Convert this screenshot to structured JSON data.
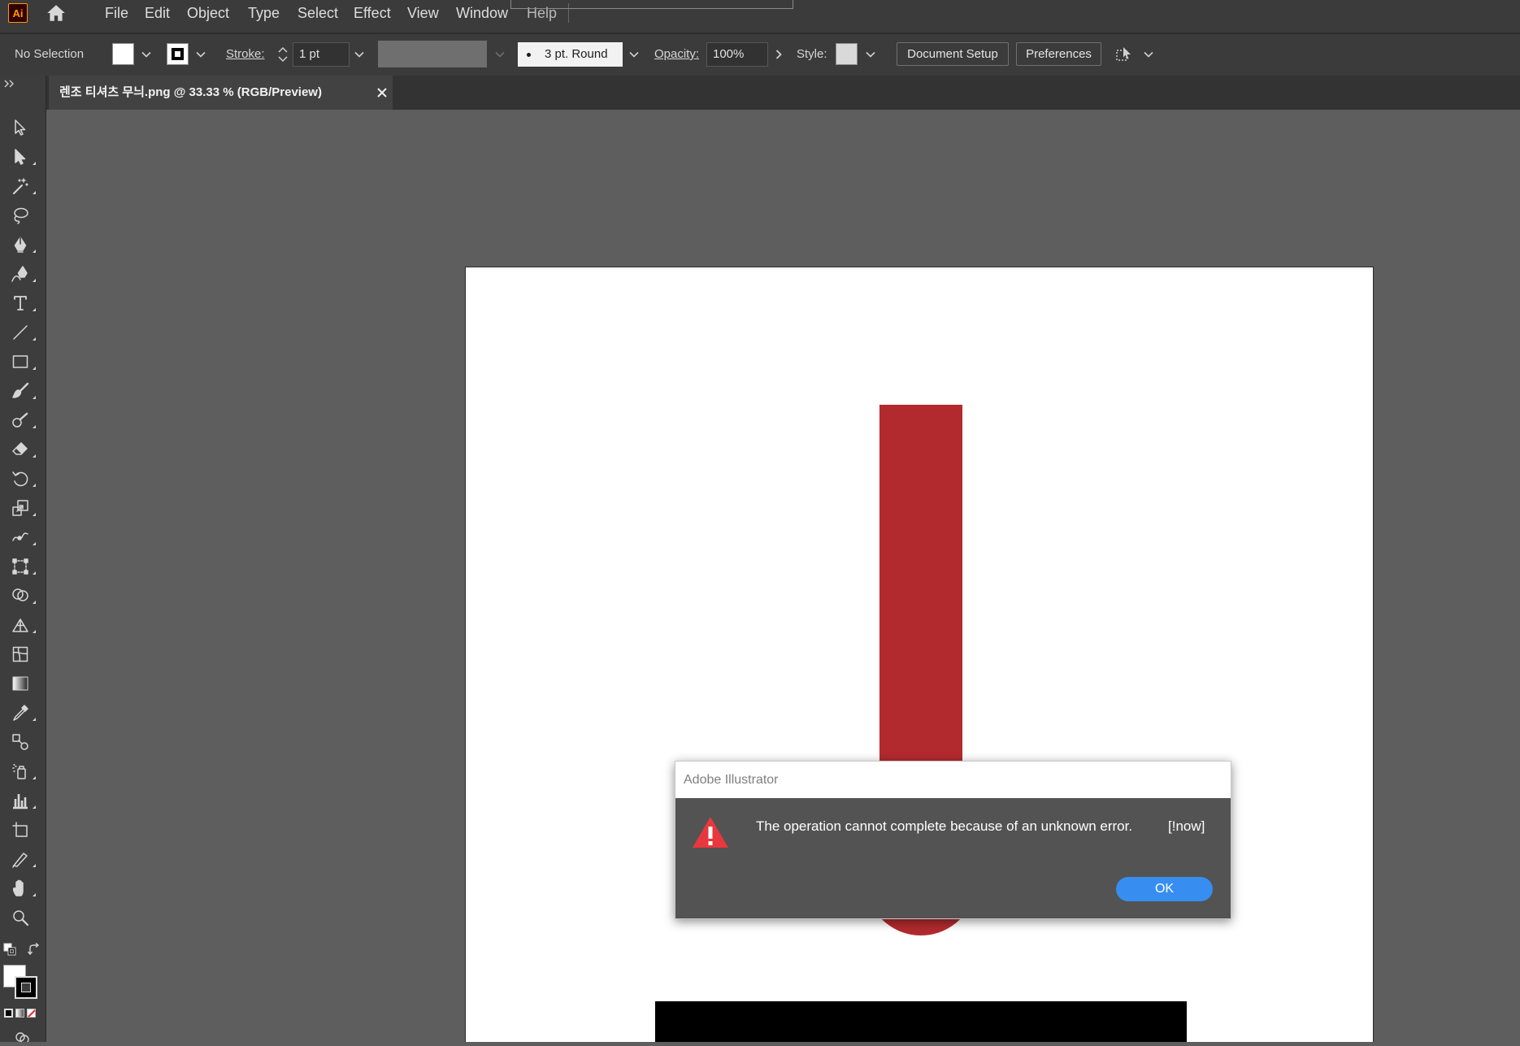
{
  "app": {
    "logo_text": "Ai"
  },
  "menu": {
    "items": [
      "File",
      "Edit",
      "Object",
      "Type",
      "Select",
      "Effect",
      "View",
      "Window",
      "Help"
    ]
  },
  "control_bar": {
    "selection_status": "No Selection",
    "stroke_label": "Stroke:",
    "stroke_weight": "1 pt",
    "brush_definition": "3 pt. Round",
    "opacity_label": "Opacity:",
    "opacity_value": "100%",
    "style_label": "Style:",
    "document_setup_button": "Document Setup",
    "preferences_button": "Preferences"
  },
  "document_tab": {
    "title": "렌조 티셔츠 무늬.png @ 33.33 % (RGB/Preview)"
  },
  "tools": [
    "selection-tool-icon",
    "direct-selection-tool-icon",
    "magic-wand-tool-icon",
    "lasso-tool-icon",
    "pen-tool-icon",
    "curvature-tool-icon",
    "type-tool-icon",
    "line-segment-tool-icon",
    "rectangle-tool-icon",
    "paintbrush-tool-icon",
    "blob-brush-tool-icon",
    "eraser-tool-icon",
    "rotate-tool-icon",
    "scale-tool-icon",
    "width-tool-icon",
    "free-transform-tool-icon",
    "shape-builder-tool-icon",
    "perspective-grid-tool-icon",
    "mesh-tool-icon",
    "gradient-tool-icon",
    "eyedropper-tool-icon",
    "blend-tool-icon",
    "symbol-sprayer-tool-icon",
    "column-graph-tool-icon",
    "artboard-tool-icon",
    "slice-tool-icon",
    "hand-tool-icon",
    "zoom-tool-icon"
  ],
  "dialog": {
    "title": "Adobe Illustrator",
    "message": "The operation cannot complete because of an unknown error.",
    "error_code": "[!now]",
    "ok_button": "OK"
  },
  "colors": {
    "accent": "#378ef0",
    "warning": "#e8373e",
    "artwork_red": "#b22a2e",
    "artwork_black": "#000000",
    "fill_swatch": "#ffffff",
    "style_swatch": "#d9d9d9",
    "logo_bg": "#330000",
    "logo_fg": "#ff9a00"
  }
}
